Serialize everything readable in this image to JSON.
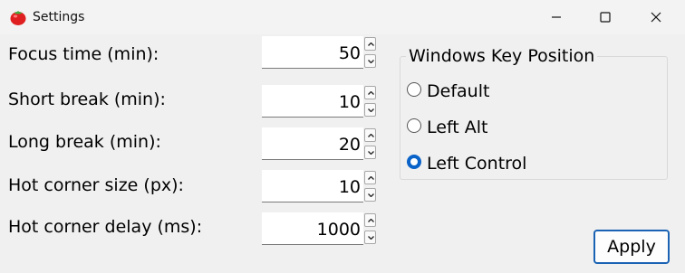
{
  "window": {
    "title": "Settings",
    "app_icon": "tomato-icon",
    "controls": [
      "minimize-icon",
      "maximize-icon",
      "close-icon"
    ]
  },
  "fields": [
    {
      "label": "Focus time (min):",
      "value": "50"
    },
    {
      "label": "Short break (min):",
      "value": "10"
    },
    {
      "label": "Long break (min):",
      "value": "20"
    },
    {
      "label": "Hot corner size (px):",
      "value": "10"
    },
    {
      "label": "Hot corner delay (ms):",
      "value": "1000"
    }
  ],
  "windows_key": {
    "title": "Windows Key Position",
    "options": [
      "Default",
      "Left Alt",
      "Left Control"
    ],
    "selected": "Left Control"
  },
  "apply_label": "Apply",
  "colors": {
    "accent": "#0a63c9",
    "background": "#f0f0f0",
    "input_background": "#ffffff"
  }
}
